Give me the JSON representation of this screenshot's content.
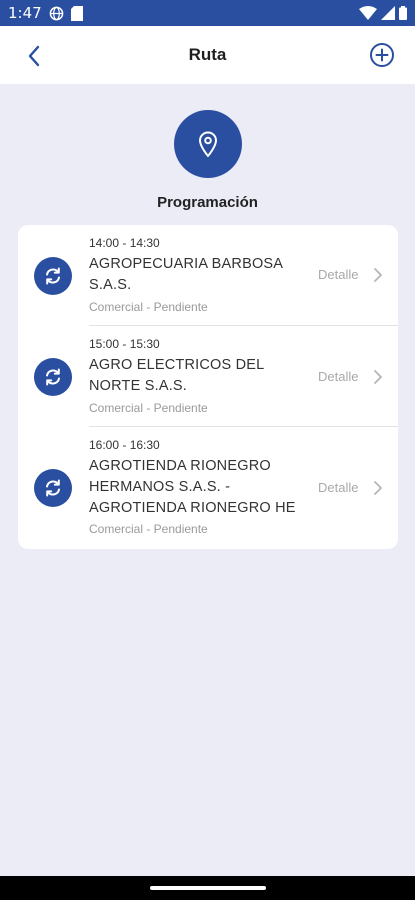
{
  "status_bar": {
    "time": "1:47"
  },
  "header": {
    "title": "Ruta"
  },
  "section": {
    "title": "Programación"
  },
  "detail_label": "Detalle",
  "items": [
    {
      "time": "14:00 - 14:30",
      "name": "AGROPECUARIA BARBOSA S.A.S.",
      "status": "Comercial - Pendiente"
    },
    {
      "time": "15:00 - 15:30",
      "name": "AGRO ELECTRICOS DEL NORTE S.A.S.",
      "status": "Comercial - Pendiente"
    },
    {
      "time": "16:00 - 16:30",
      "name": "AGROTIENDA RIONEGRO HERMANOS S.A.S. - AGROTIENDA RIONEGRO HE",
      "status": "Comercial - Pendiente"
    }
  ],
  "colors": {
    "primary": "#2a4fa0",
    "background": "#ebecf6"
  },
  "icons": {
    "back": "chevron-left-icon",
    "add": "add-circle-icon",
    "location": "location-pin-icon",
    "sync": "sync-icon"
  }
}
